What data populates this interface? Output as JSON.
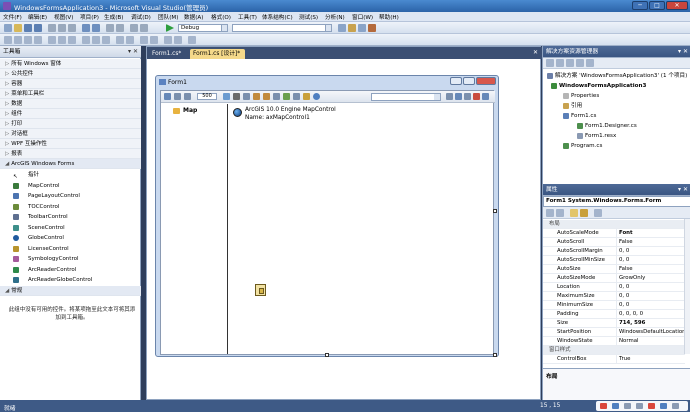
{
  "window": {
    "title": "WindowsFormsApplication3 - Microsoft Visual Studio(管理员)",
    "controls": [
      "─",
      "□",
      "✕"
    ]
  },
  "menu": [
    "文件(F)",
    "编辑(E)",
    "视图(V)",
    "项目(P)",
    "生成(B)",
    "调试(D)",
    "团队(M)",
    "数据(A)",
    "格式(O)",
    "工具(T)",
    "体系结构(C)",
    "测试(S)",
    "分析(N)",
    "窗口(W)",
    "帮助(H)"
  ],
  "toolbar": {
    "config": "Debug",
    "platform": "",
    "find": ""
  },
  "toolbox": {
    "title": "工具箱",
    "pin": "▾ ✕",
    "sections": [
      "所有 Windows 窗体",
      "公共控件",
      "容器",
      "菜单和工具栏",
      "数据",
      "组件",
      "打印",
      "对话框",
      "WPF 互操作性",
      "报表"
    ],
    "arcgis_section": "ArcGIS Windows Forms",
    "arcgis_items": [
      "指针",
      "MapControl",
      "PageLayoutControl",
      "TOCControl",
      "ToolbarControl",
      "SceneControl",
      "GlobeControl",
      "LicenseControl",
      "SymbologyControl",
      "ArcReaderControl",
      "ArcReaderGlobeControl"
    ],
    "general_section": "常规",
    "empty_msg": "此组中没有可用的控件。将某项拖至此文本可将其添加到工具箱。"
  },
  "tabs": [
    {
      "label": "Form1.cs*",
      "active": false
    },
    {
      "label": "Form1.cs [设计]*",
      "active": true
    }
  ],
  "tab_close": "✕",
  "form": {
    "title": "Form1",
    "zoom": "500",
    "toc_root": "Map",
    "mapcontrol_line1": "ArcGIS 10.0 Engine MapControl",
    "mapcontrol_line2": "Name: axMapControl1"
  },
  "solution_explorer": {
    "title": "解决方案资源管理器",
    "items": [
      {
        "text": "解决方案 'WindowsFormsApplication3' (1 个项目)",
        "bold": false
      },
      {
        "text": "WindowsFormsApplication3",
        "bold": true
      },
      {
        "text": "Properties",
        "bold": false
      },
      {
        "text": "引用",
        "bold": false
      },
      {
        "text": "Form1.cs",
        "bold": false
      },
      {
        "text": "Form1.Designer.cs",
        "bold": false
      },
      {
        "text": "Form1.resx",
        "bold": false
      },
      {
        "text": "Program.cs",
        "bold": false
      }
    ]
  },
  "properties": {
    "title": "属性",
    "object": "Form1 System.Windows.Forms.Form",
    "rows": [
      {
        "cat": true,
        "name": "布局"
      },
      {
        "name": "AutoScaleMode",
        "value": "Font"
      },
      {
        "name": "AutoScroll",
        "value": "False"
      },
      {
        "name": "AutoScrollMargin",
        "value": "0, 0"
      },
      {
        "name": "AutoScrollMinSize",
        "value": "0, 0"
      },
      {
        "name": "AutoSize",
        "value": "False"
      },
      {
        "name": "AutoSizeMode",
        "value": "GrowOnly"
      },
      {
        "name": "Location",
        "value": "0, 0"
      },
      {
        "name": "MaximumSize",
        "value": "0, 0"
      },
      {
        "name": "MinimumSize",
        "value": "0, 0"
      },
      {
        "name": "Padding",
        "value": "0, 0, 0, 0"
      },
      {
        "name": "Size",
        "value": "714, 596"
      },
      {
        "name": "StartPosition",
        "value": "WindowsDefaultLocation"
      },
      {
        "name": "WindowState",
        "value": "Normal"
      },
      {
        "cat": true,
        "name": "窗口样式"
      },
      {
        "name": "ControlBox",
        "value": "True"
      }
    ],
    "desc_title": "布局"
  },
  "status": {
    "text": "就绪",
    "position": "15 , 15"
  },
  "colors": {
    "accent": "#2b63a8",
    "active_tab": "#f5d98a",
    "toolbar": "#d5e0ef"
  }
}
